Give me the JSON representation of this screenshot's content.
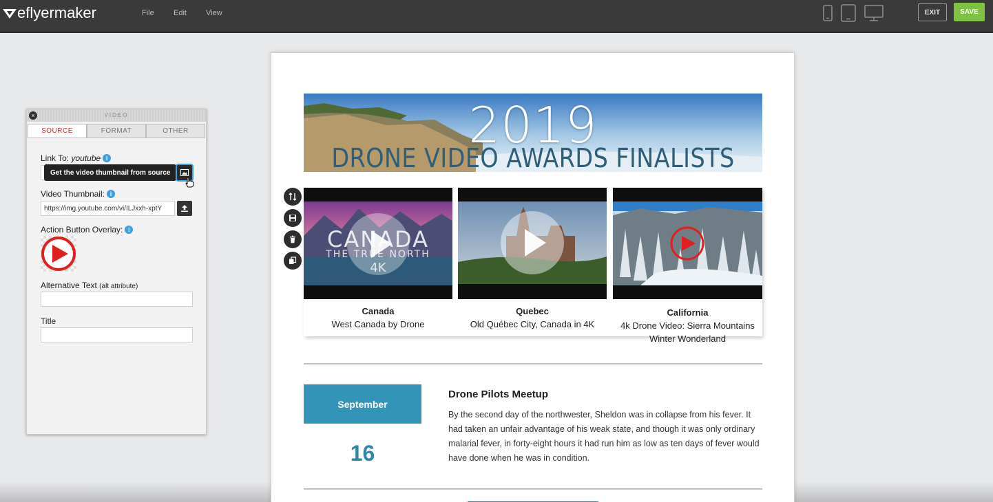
{
  "app": {
    "logo_text": "eflyermaker",
    "menu": [
      "File",
      "Edit",
      "View"
    ],
    "devices": [
      "phone-icon",
      "tablet-icon",
      "desktop-icon"
    ],
    "exit_label": "EXIT",
    "save_label": "SAVE"
  },
  "panel": {
    "title": "VIDEO",
    "tabs": [
      "SOURCE",
      "FORMAT",
      "OTHER"
    ],
    "active_tab": "SOURCE",
    "link_to_label": "Link To:",
    "link_to_value": "youtube",
    "tooltip": "Get the video thumbnail from source",
    "thumbnail_label": "Video Thumbnail:",
    "thumbnail_value": "https://img.youtube.com/vi/ILJxxh-xptY",
    "overlay_label": "Action Button Overlay:",
    "alt_label": "Alternative Text",
    "alt_hint": "(alt attribute)",
    "alt_value": "",
    "title_label": "Title",
    "title_value": ""
  },
  "flyer": {
    "hero_year": "2019",
    "hero_subtitle": "DRONE VIDEO AWARDS FINALISTS",
    "videos": [
      {
        "title": "Canada",
        "caption": "West Canada by Drone",
        "thumb_line1": "CANADA",
        "thumb_line2": "THE TRUE NORTH",
        "thumb_line3": "4K"
      },
      {
        "title": "Quebec",
        "caption": "Old Québec City, Canada in 4K"
      },
      {
        "title": "California",
        "caption": "4k Drone Video: Sierra Mountains Winter Wonderland"
      }
    ],
    "event": {
      "month": "September",
      "day": "16",
      "title": "Drone Pilots Meetup",
      "text": "By the second day of the northwester, Sheldon was in collapse from his fever. It had taken an unfair advantage of his weak state, and though it was only ordinary malarial fever, in forty-eight hours it had run him as low as ten days of fever would have done when he was in condition."
    }
  },
  "colors": {
    "topbar": "#3a3a3a",
    "save": "#7fc241",
    "accent_blue": "#3394b8",
    "tab_active": "#c8282a",
    "play_red": "#e0201f"
  }
}
